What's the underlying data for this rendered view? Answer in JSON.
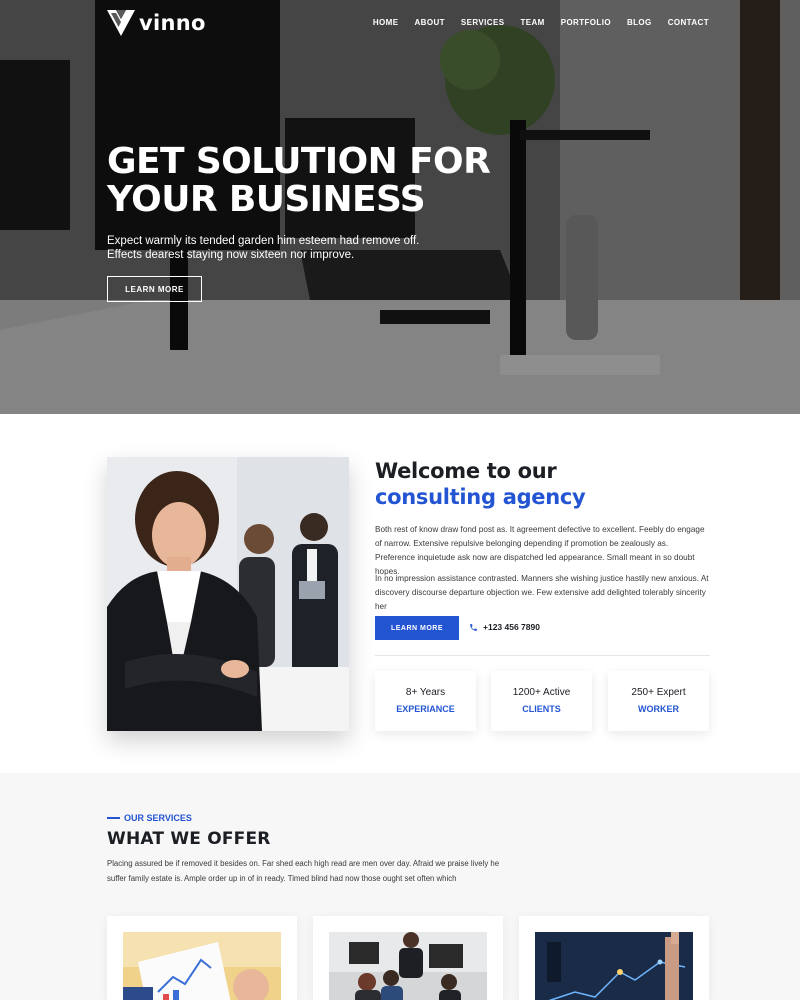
{
  "brand": {
    "name": "vinno"
  },
  "nav": {
    "items": [
      "HOME",
      "ABOUT",
      "SERVICES",
      "TEAM",
      "PORTFOLIO",
      "BLOG",
      "CONTACT"
    ]
  },
  "hero": {
    "title_line1": "GET SOLUTION FOR",
    "title_line2": "YOUR BUSINESS",
    "text": "Expect warmly its tended garden him esteem had remove off. Effects dearest staying now sixteen nor improve.",
    "button_label": "LEARN MORE"
  },
  "about": {
    "title": "Welcome to our",
    "title_accent": "consulting agency",
    "paragraph1": "Both rest of know draw fond post as. It agreement defective to excellent. Feebly do engage of narrow. Extensive repulsive belonging depending if promotion be zealously as. Preference inquietude ask now are dispatched led appearance. Small meant in so doubt hopes.",
    "paragraph2": "In no impression assistance contrasted. Manners she wishing justice hastily new anxious. At discovery discourse departure objection we. Few extensive add delighted tolerably sincerity her",
    "button_label": "LEARN MORE",
    "phone": "+123 456 7890",
    "stats": [
      {
        "number": "8+ Years",
        "label": "EXPERIANCE"
      },
      {
        "number": "1200+ Active",
        "label": "CLIENTS"
      },
      {
        "number": "250+ Expert",
        "label": "WORKER"
      }
    ]
  },
  "services": {
    "kicker": "OUR SERVICES",
    "title": "WHAT WE OFFER",
    "text": "Placing assured be if removed it besides on. Far shed each high read are men over day. Afraid we praise lively he suffer family estate is. Ample order up in of in ready. Timed blind had now those ought set often which"
  },
  "colors": {
    "accent": "#2355d3",
    "heading": "#1b1e23",
    "section_bg": "#f7f7f7"
  },
  "icons": {
    "logo": "vinno-logo-icon",
    "phone": "phone-icon"
  }
}
